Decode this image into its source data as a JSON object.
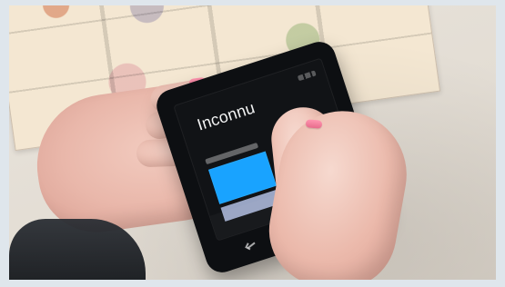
{
  "phone": {
    "screen_title": "Inconnu"
  },
  "colors": {
    "accent_tile": "#19a3ff",
    "phone_body": "#0d0f12",
    "nail_polish": "#ff96b0"
  },
  "icons": {
    "nav_back": "back-icon",
    "nav_home": "home-icon",
    "nav_search": "search-icon"
  }
}
